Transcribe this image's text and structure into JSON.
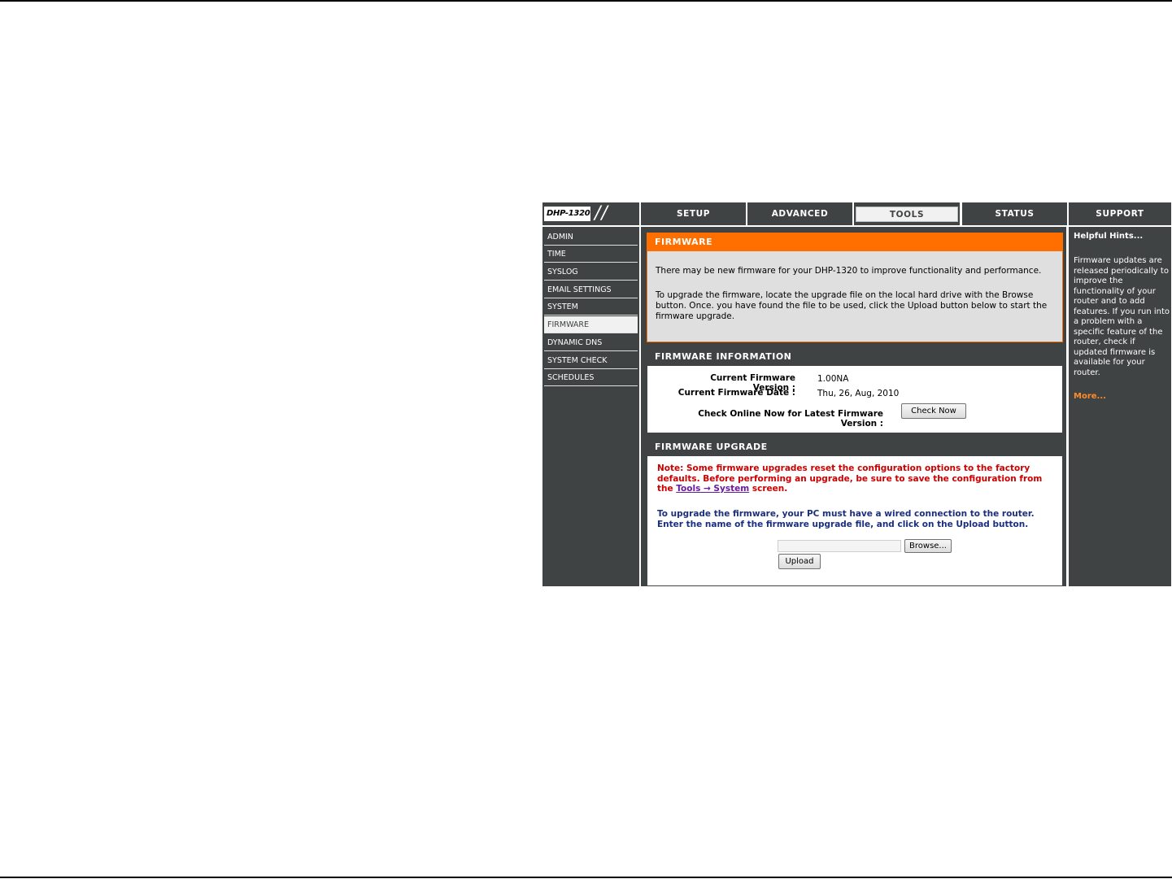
{
  "header": {
    "logo_text": "DHP-1320",
    "tabs": [
      {
        "label": "SETUP",
        "active": false
      },
      {
        "label": "ADVANCED",
        "active": false
      },
      {
        "label": "TOOLS",
        "active": true
      },
      {
        "label": "STATUS",
        "active": false
      },
      {
        "label": "SUPPORT",
        "active": false
      }
    ]
  },
  "sidebar": {
    "items": [
      {
        "label": "ADMIN"
      },
      {
        "label": "TIME"
      },
      {
        "label": "SYSLOG"
      },
      {
        "label": "EMAIL SETTINGS"
      },
      {
        "label": "SYSTEM"
      },
      {
        "label": "FIRMWARE",
        "active": true
      },
      {
        "label": "DYNAMIC DNS"
      },
      {
        "label": "SYSTEM CHECK"
      },
      {
        "label": "SCHEDULES"
      }
    ]
  },
  "firmware": {
    "title": "FIRMWARE",
    "line1": "There may be new firmware for your DHP-1320 to improve functionality and performance.",
    "line2": "To upgrade the firmware, locate the upgrade file on the local hard drive with the Browse button. Once. you have found the file to be used, click the Upload button below to start the firmware upgrade."
  },
  "firmware_info": {
    "title": "FIRMWARE INFORMATION",
    "version_label": "Current Firmware Version :",
    "version_value": "1.00NA",
    "date_label": "Current Firmware Date :",
    "date_value": "Thu, 26, Aug, 2010",
    "check_label": "Check Online Now for Latest Firmware Version :",
    "check_button": "Check Now"
  },
  "firmware_upgrade": {
    "title": "FIRMWARE UPGRADE",
    "note_prefix": "Note: Some firmware upgrades reset the configuration options to the factory defaults. Before performing an upgrade, be sure to save the configuration from the ",
    "note_link": "Tools → System",
    "note_suffix": " screen.",
    "instructions": "To upgrade the firmware, your PC must have a wired connection to the router. Enter the name of the firmware upgrade file, and click on the Upload button.",
    "file_value": "",
    "browse_button": "Browse...",
    "upload_button": "Upload"
  },
  "hints": {
    "title": "Helpful Hints...",
    "body": "Firmware updates are released periodically to improve the functionality of your router and to add features. If you run into a problem with a specific feature of the router, check if updated firmware is available for your router.",
    "more": "More..."
  }
}
